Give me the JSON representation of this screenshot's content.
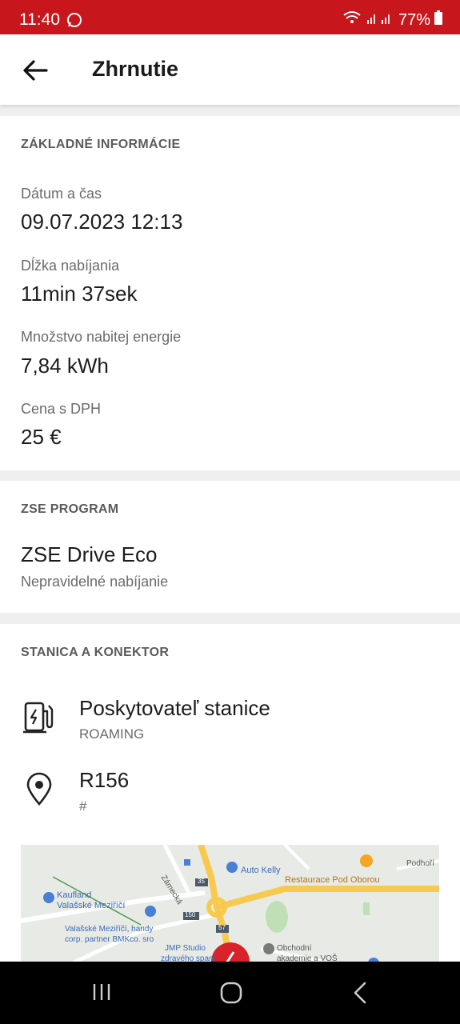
{
  "status_bar": {
    "time": "11:40",
    "battery": "77%"
  },
  "header": {
    "title": "Zhrnutie"
  },
  "basic_info": {
    "heading": "ZÁKLADNÉ INFORMÁCIE",
    "fields": [
      {
        "label": "Dátum a čas",
        "value": "09.07.2023 12:13"
      },
      {
        "label": "Dĺžka nabíjania",
        "value": "11min 37sek"
      },
      {
        "label": "Množstvo nabitej energie",
        "value": "7,84 kWh"
      },
      {
        "label": "Cena s DPH",
        "value": "25 €"
      }
    ]
  },
  "program": {
    "heading": "ZSE PROGRAM",
    "name": "ZSE Drive Eco",
    "description": "Nepravidelné nabíjanie"
  },
  "station": {
    "heading": "STANICA A KONEKTOR",
    "provider_title": "Poskytovateľ stanice",
    "provider_value": "ROAMING",
    "station_id": "R156",
    "connector": "#"
  },
  "map": {
    "labels": {
      "auto_kelly": "Auto Kelly",
      "podhori": "Podhoří",
      "restaurace": "Restaurace Pod Oborou",
      "zamecka": "Zámecká",
      "kaufland_1": "Kaufland",
      "kaufland_2": "Valašské Meziříčí",
      "valasske_1": "Valašské Meziříčí, handy",
      "valasske_2": "corp. partner BMKco. sro",
      "jmp_1": "JMP Studio",
      "jmp_2": "zdravého spaní",
      "obchodni_1": "Obchodní",
      "obchodni_2": "akademie a VOŠ",
      "road_35": "35",
      "road_150": "150",
      "road_57": "57"
    }
  },
  "colors": {
    "brand_red": "#c8161d",
    "accent_orange": "#f5a623"
  }
}
